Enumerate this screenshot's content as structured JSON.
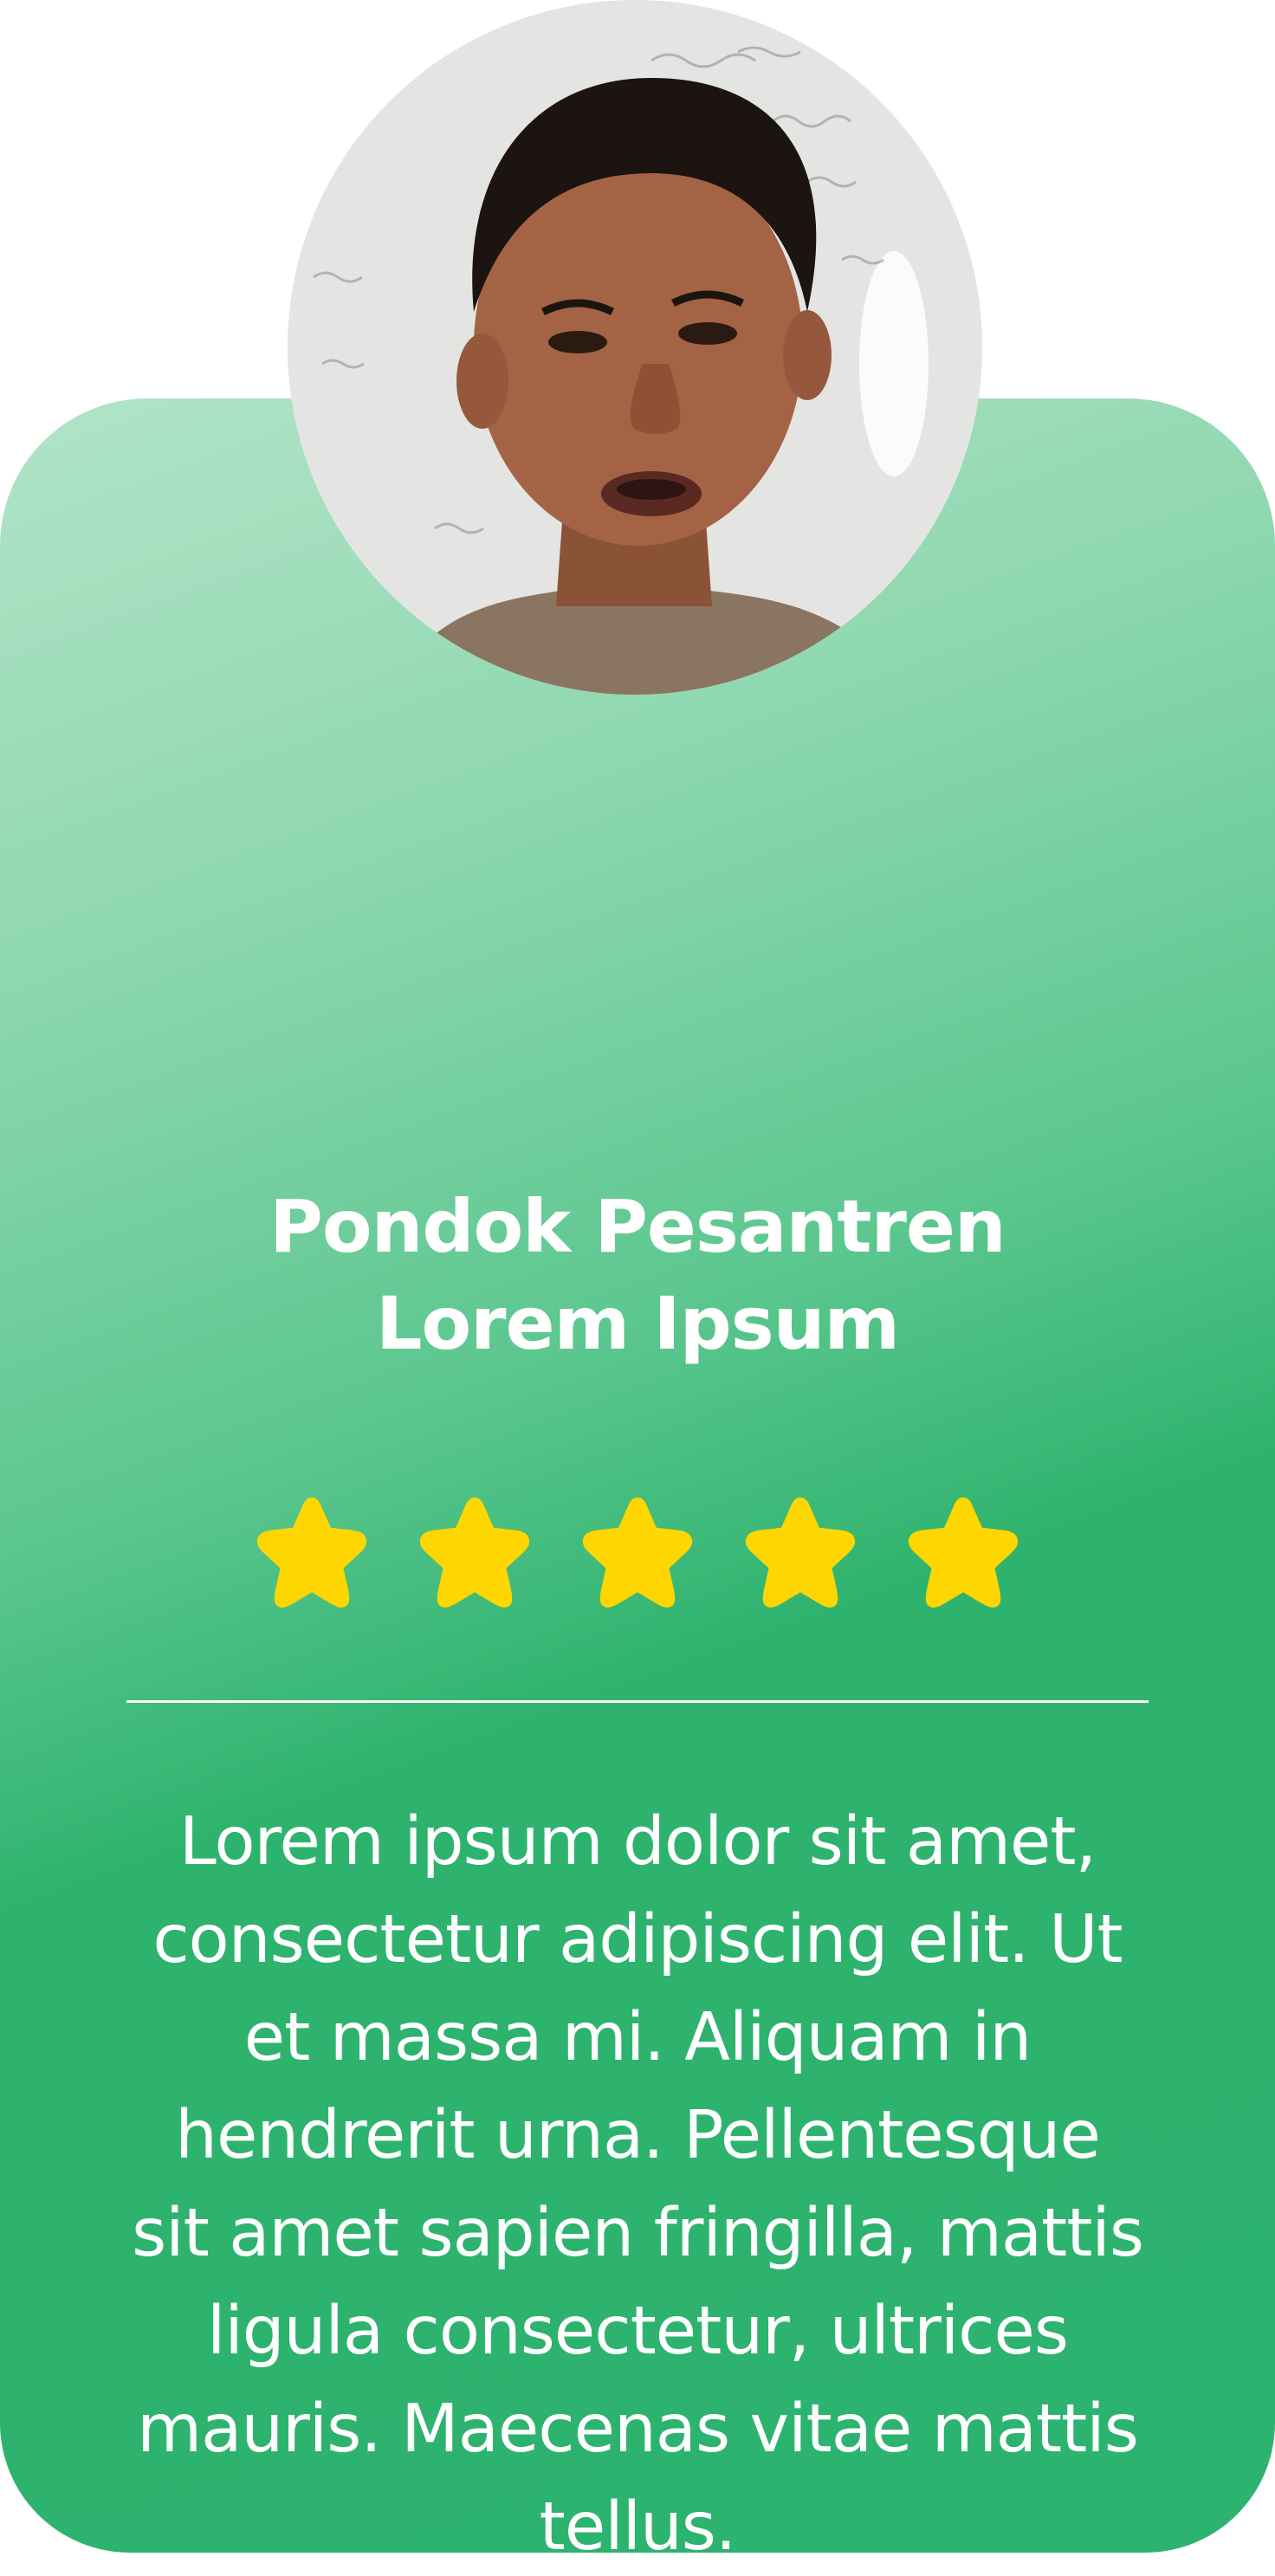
{
  "profile": {
    "name_line1": "Pondok Pesantren",
    "name_line2": "Lorem Ipsum",
    "avatar_icon": "person-photo"
  },
  "rating": {
    "value": 5,
    "max": 5,
    "icon": "star-icon",
    "star_color": "#FFD600"
  },
  "testimonial": {
    "text": "Lorem ipsum dolor sit amet, consectetur adipiscing elit. Ut et massa mi. Aliquam in hendrerit urna. Pellentesque sit amet sapien fringilla, mattis ligula consectetur, ultrices mauris. Maecenas vitae mattis tellus."
  },
  "colors": {
    "card_green": "#2CB36F",
    "card_light": "#B2E4C8",
    "text": "#FFFFFF"
  }
}
